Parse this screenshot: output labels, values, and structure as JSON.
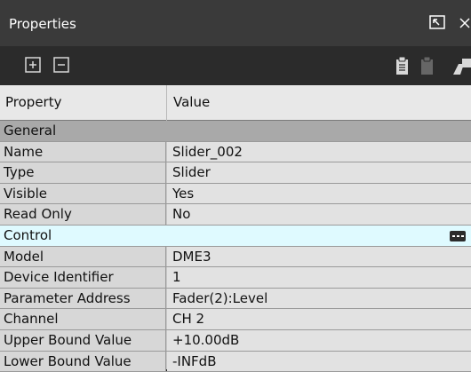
{
  "panel": {
    "title": "Properties"
  },
  "toolbar": {
    "expand_label": "+",
    "collapse_label": "−"
  },
  "grid": {
    "headers": {
      "property": "Property",
      "value": "Value"
    },
    "rows": [
      {
        "kind": "category",
        "key": "General"
      },
      {
        "kind": "prop",
        "key": "Name",
        "value": "Slider_002"
      },
      {
        "kind": "prop",
        "key": "Type",
        "value": "Slider"
      },
      {
        "kind": "prop",
        "key": "Visible",
        "value": "Yes"
      },
      {
        "kind": "prop",
        "key": "Read Only",
        "value": "No"
      },
      {
        "kind": "category",
        "key": "Control",
        "selected": true
      },
      {
        "kind": "prop",
        "key": "Model",
        "value": "DME3"
      },
      {
        "kind": "prop",
        "key": "Device Identifier",
        "value": "1"
      },
      {
        "kind": "prop",
        "key": "Parameter Address",
        "value": "Fader(2):Level"
      },
      {
        "kind": "prop",
        "key": "Channel",
        "value": "CH 2"
      },
      {
        "kind": "prop",
        "key": "Upper Bound Value",
        "value": "+10.00dB"
      },
      {
        "kind": "prop",
        "key": "Lower Bound Value",
        "value": "-INFdB"
      }
    ]
  }
}
